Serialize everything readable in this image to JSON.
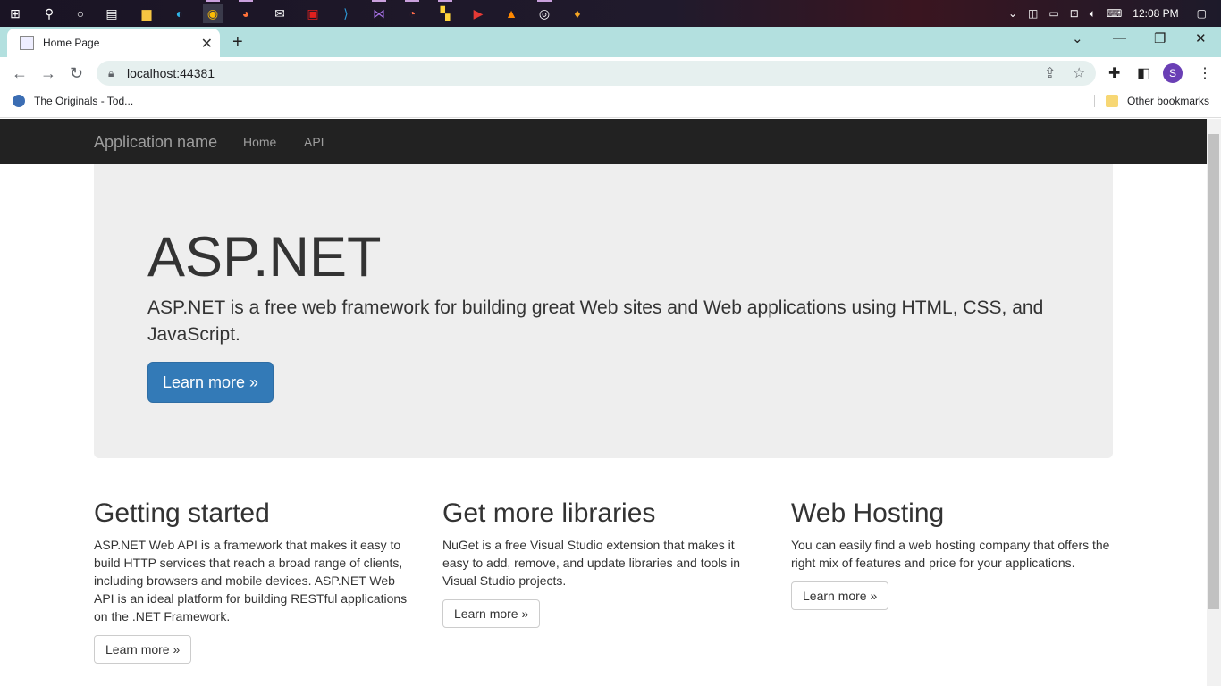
{
  "taskbar": {
    "time": "12:08 PM",
    "icons": [
      "windows-start-icon",
      "search-icon",
      "cortana-icon",
      "task-view-icon",
      "file-explorer-icon",
      "edge-icon",
      "chrome-icon",
      "firefox-icon",
      "mail-icon",
      "acrobat-icon",
      "vscode-icon",
      "visual-studio-icon",
      "app-icon",
      "python-icon",
      "media-icon",
      "vlc-icon",
      "settings-icon",
      "fl-studio-icon"
    ]
  },
  "browser": {
    "tab_title": "Home Page",
    "url": "localhost:44381",
    "profile_initial": "S",
    "bookmarks": [
      {
        "label": "The Originals - Tod..."
      },
      {
        "label": "Other bookmarks"
      }
    ]
  },
  "page": {
    "navbar": {
      "brand": "Application name",
      "links": [
        "Home",
        "API"
      ]
    },
    "jumbotron": {
      "title": "ASP.NET",
      "lead": "ASP.NET is a free web framework for building great Web sites and Web applications using HTML, CSS, and JavaScript.",
      "button": "Learn more »"
    },
    "columns": [
      {
        "heading": "Getting started",
        "text": "ASP.NET Web API is a framework that makes it easy to build HTTP services that reach a broad range of clients, including browsers and mobile devices. ASP.NET Web API is an ideal platform for building RESTful applications on the .NET Framework.",
        "button": "Learn more »"
      },
      {
        "heading": "Get more libraries",
        "text": "NuGet is a free Visual Studio extension that makes it easy to add, remove, and update libraries and tools in Visual Studio projects.",
        "button": "Learn more »"
      },
      {
        "heading": "Web Hosting",
        "text": "You can easily find a web hosting company that offers the right mix of features and price for your applications.",
        "button": "Learn more »"
      }
    ]
  },
  "colors": {
    "navbar_bg": "#222222",
    "jumbotron_bg": "#eeeeee",
    "primary": "#337ab7",
    "tabstrip": "#b3e0df"
  }
}
